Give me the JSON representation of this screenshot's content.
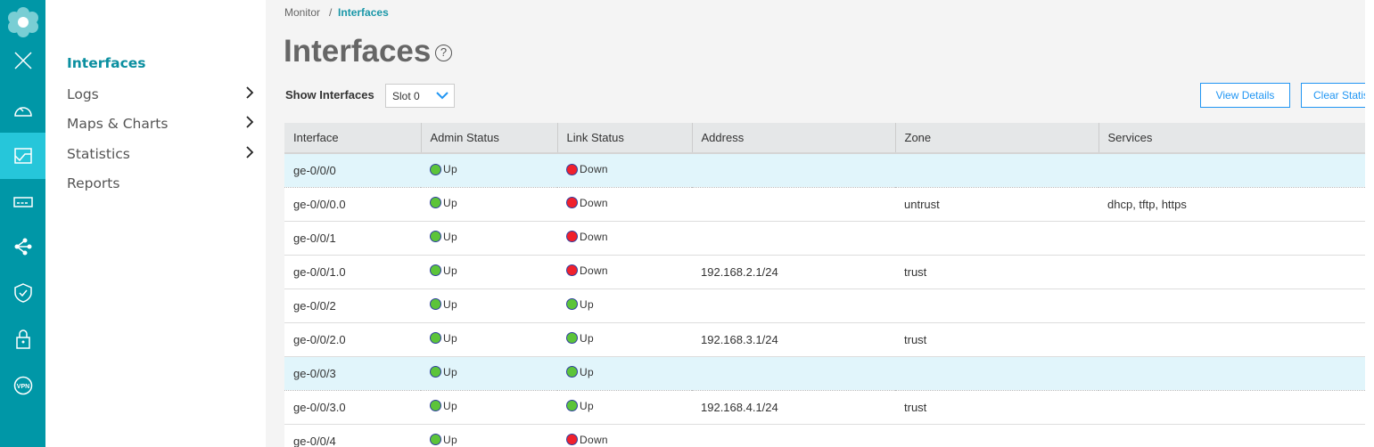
{
  "rail": {
    "items": [
      "logo-icon",
      "close-icon",
      "dashboard-icon",
      "monitor-icon",
      "device-icon",
      "network-icon",
      "security-icon",
      "lock-icon",
      "vpn-icon"
    ],
    "vpn_label": "VPN"
  },
  "submenu": {
    "items": [
      {
        "label": "Interfaces",
        "active": true,
        "arrow": false
      },
      {
        "label": "Logs",
        "arrow": true
      },
      {
        "label": "Maps & Charts",
        "arrow": true
      },
      {
        "label": "Statistics",
        "arrow": true
      },
      {
        "label": "Reports",
        "arrow": false
      }
    ]
  },
  "breadcrumb": {
    "parent": "Monitor",
    "separator": "/",
    "current": "Interfaces"
  },
  "page": {
    "title": "Interfaces",
    "help": "?"
  },
  "filter": {
    "label": "Show Interfaces",
    "value": "Slot 0"
  },
  "buttons": {
    "view_details": "View Details",
    "clear_statistics": "Clear Statistics"
  },
  "colors": {
    "up": "#5cc43a",
    "down": "#f0212c",
    "accent": "#0097a7"
  },
  "table": {
    "columns": [
      "Interface",
      "Admin Status",
      "Link Status",
      "Address",
      "Zone",
      "Services"
    ],
    "rows": [
      {
        "interface": "ge-0/0/0",
        "admin": "Up",
        "link": "Down",
        "address": "",
        "zone": "",
        "services": "",
        "highlight": true
      },
      {
        "interface": "ge-0/0/0.0",
        "admin": "Up",
        "link": "Down",
        "address": "",
        "zone": "untrust",
        "services": "dhcp, tftp, https"
      },
      {
        "interface": "ge-0/0/1",
        "admin": "Up",
        "link": "Down",
        "address": "",
        "zone": "",
        "services": ""
      },
      {
        "interface": "ge-0/0/1.0",
        "admin": "Up",
        "link": "Down",
        "address": "192.168.2.1/24",
        "zone": "trust",
        "services": ""
      },
      {
        "interface": "ge-0/0/2",
        "admin": "Up",
        "link": "Up",
        "address": "",
        "zone": "",
        "services": ""
      },
      {
        "interface": "ge-0/0/2.0",
        "admin": "Up",
        "link": "Up",
        "address": "192.168.3.1/24",
        "zone": "trust",
        "services": ""
      },
      {
        "interface": "ge-0/0/3",
        "admin": "Up",
        "link": "Up",
        "address": "",
        "zone": "",
        "services": "",
        "highlight": true
      },
      {
        "interface": "ge-0/0/3.0",
        "admin": "Up",
        "link": "Up",
        "address": "192.168.4.1/24",
        "zone": "trust",
        "services": ""
      },
      {
        "interface": "ge-0/0/4",
        "admin": "Up",
        "link": "Down",
        "address": "",
        "zone": "",
        "services": ""
      }
    ]
  }
}
